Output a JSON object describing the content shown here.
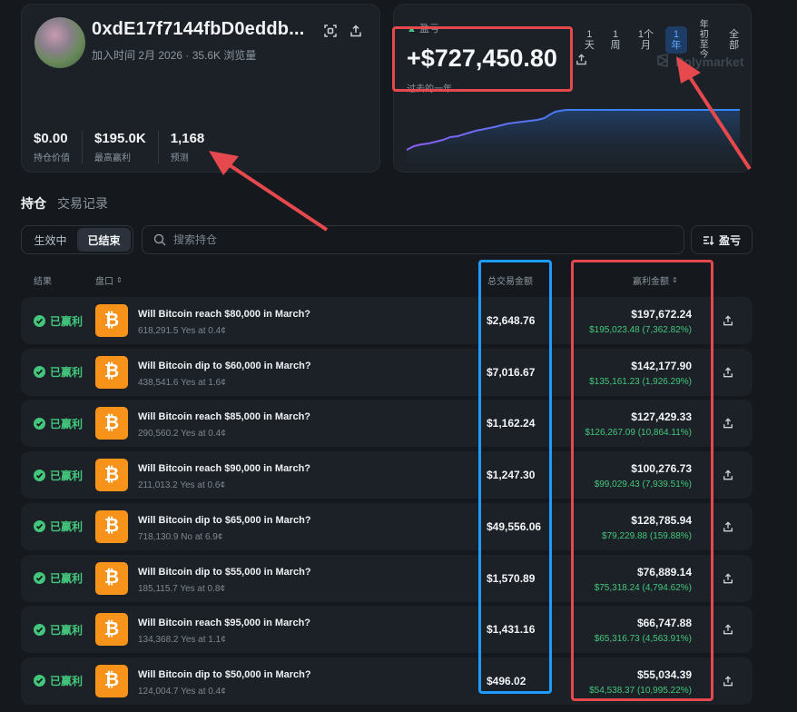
{
  "profile": {
    "address": "0xdE17f7144fbD0eddb...",
    "joined": "加入时间 2月 2026 · 35.6K 浏览量",
    "stats": [
      {
        "value": "$0.00",
        "label": "持仓价值"
      },
      {
        "value": "$195.0K",
        "label": "最高赢利"
      },
      {
        "value": "1,168",
        "label": "预测"
      }
    ]
  },
  "pnl": {
    "label": "盈亏",
    "value": "+$727,450.80",
    "sub": "过去的一年",
    "brand": "Polymarket",
    "ranges": [
      "1天",
      "1周",
      "1个月",
      "1年",
      "年初至今",
      "全部"
    ],
    "active_range": "1年"
  },
  "tabs": [
    "持仓",
    "交易记录"
  ],
  "segment": [
    "生效中",
    "已结束"
  ],
  "search": {
    "placeholder": "搜索持仓"
  },
  "sort_button": "盈亏",
  "columns": {
    "result": "结果",
    "market": "盘口",
    "traded": "总交易金额",
    "profit": "赢利金额"
  },
  "rows": [
    {
      "status": "已赢利",
      "title": "Will Bitcoin reach $80,000 in March?",
      "sub": "618,291.5 Yes at 0.4¢",
      "traded": "$2,648.76",
      "profit": "$197,672.24",
      "profit_sub": "$195,023.48 (7,362.82%)"
    },
    {
      "status": "已赢利",
      "title": "Will Bitcoin dip to $60,000 in March?",
      "sub": "438,541.6 Yes at 1.6¢",
      "traded": "$7,016.67",
      "profit": "$142,177.90",
      "profit_sub": "$135,161.23 (1,926.29%)"
    },
    {
      "status": "已赢利",
      "title": "Will Bitcoin reach $85,000 in March?",
      "sub": "290,560.2 Yes at 0.4¢",
      "traded": "$1,162.24",
      "profit": "$127,429.33",
      "profit_sub": "$126,267.09 (10,864.11%)"
    },
    {
      "status": "已赢利",
      "title": "Will Bitcoin reach $90,000 in March?",
      "sub": "211,013.2 Yes at 0.6¢",
      "traded": "$1,247.30",
      "profit": "$100,276.73",
      "profit_sub": "$99,029.43 (7,939.51%)"
    },
    {
      "status": "已赢利",
      "title": "Will Bitcoin dip to $65,000 in March?",
      "sub": "718,130.9 No at 6.9¢",
      "traded": "$49,556.06",
      "profit": "$128,785.94",
      "profit_sub": "$79,229.88 (159.88%)"
    },
    {
      "status": "已赢利",
      "title": "Will Bitcoin dip to $55,000 in March?",
      "sub": "185,115.7 Yes at 0.8¢",
      "traded": "$1,570.89",
      "profit": "$76,889.14",
      "profit_sub": "$75,318.24 (4,794.62%)"
    },
    {
      "status": "已赢利",
      "title": "Will Bitcoin reach $95,000 in March?",
      "sub": "134,368.2 Yes at 1.1¢",
      "traded": "$1,431.16",
      "profit": "$66,747.88",
      "profit_sub": "$65,316.73 (4,563.91%)"
    },
    {
      "status": "已赢利",
      "title": "Will Bitcoin dip to $50,000 in March?",
      "sub": "124,004.7 Yes at 0.4¢",
      "traded": "$496.02",
      "profit": "$55,034.39",
      "profit_sub": "$54,538.37 (10,995.22%)"
    }
  ],
  "colors": {
    "profit_green": "#43c77c",
    "accent_blue": "#5fa8ff",
    "highlight_red": "#e5484d",
    "highlight_blue": "#1e9bff",
    "bitcoin_orange": "#f7931a"
  },
  "icons": [
    "qr-scan-icon",
    "share-icon",
    "search-icon",
    "sort-icon",
    "check-icon",
    "bitcoin-icon",
    "polymarket-logo-icon"
  ]
}
